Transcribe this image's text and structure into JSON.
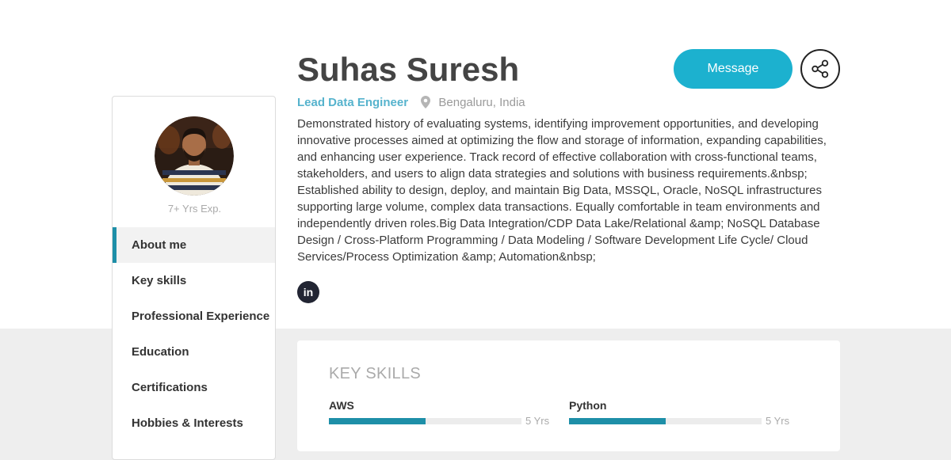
{
  "profile": {
    "name": "Suhas Suresh",
    "role": "Lead Data Engineer",
    "location": "Bengaluru, India",
    "experience": "7+ Yrs Exp.",
    "summary": "Demonstrated history of evaluating systems, identifying improvement opportunities, and developing innovative processes aimed at optimizing the flow and storage of information, expanding capabilities, and enhancing user experience. Track record of effective collaboration with cross-functional teams, stakeholders, and users to align data strategies and solutions with business requirements.&nbsp; Established ability to design, deploy, and maintain Big Data, MSSQL, Oracle, NoSQL infrastructures supporting large volume, complex data transactions. Equally comfortable in team environments and independently driven roles.Big Data Integration/CDP Data Lake/Relational &amp; NoSQL Database Design / Cross-Platform Programming / Data Modeling / Software Development Life Cycle/ Cloud Services/Process Optimization &amp; Automation&nbsp;",
    "linkedin_label": "in"
  },
  "actions": {
    "message_label": "Message",
    "share_icon": "share-icon"
  },
  "sidebar": {
    "items": [
      {
        "label": "About me",
        "active": true
      },
      {
        "label": "Key skills",
        "active": false
      },
      {
        "label": "Professional Experience",
        "active": false
      },
      {
        "label": "Education",
        "active": false
      },
      {
        "label": "Certifications",
        "active": false
      },
      {
        "label": "Hobbies & Interests",
        "active": false
      }
    ]
  },
  "key_skills": {
    "heading": "KEY SKILLS",
    "skills": [
      {
        "name": "AWS",
        "years": "5 Yrs",
        "level": 0.5
      },
      {
        "name": "Python",
        "years": "5 Yrs",
        "level": 0.5
      }
    ]
  },
  "colors": {
    "accent": "#1cb1cf",
    "accent_dark": "#1e8fa8",
    "role_text": "#56b3cd",
    "page_bg": "#eeeeee"
  }
}
